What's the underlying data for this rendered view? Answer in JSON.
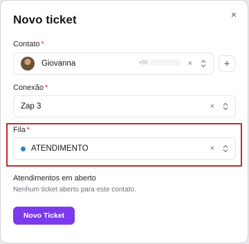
{
  "modal": {
    "title": "Novo ticket",
    "close_icon": "×"
  },
  "contato": {
    "label": "Contato",
    "required_mark": "*",
    "value": "Giovanna",
    "phone_prefix": "+55",
    "clear_icon": "×",
    "add_icon": "+"
  },
  "conexao": {
    "label": "Conexão",
    "required_mark": "*",
    "value": "Zap 3",
    "clear_icon": "×"
  },
  "fila": {
    "label": "Fila",
    "required_mark": "*",
    "value": "ATENDIMENTO",
    "dot_color": "#2f80d1",
    "clear_icon": "×"
  },
  "atendimentos": {
    "heading": "Atendimentos em aberto",
    "empty_text": "Nenhum ticket aberto para este contato."
  },
  "actions": {
    "primary_label": "Novo Ticket"
  },
  "colors": {
    "primary": "#7c3aed",
    "highlight": "#c62828",
    "required": "#e11d48"
  }
}
